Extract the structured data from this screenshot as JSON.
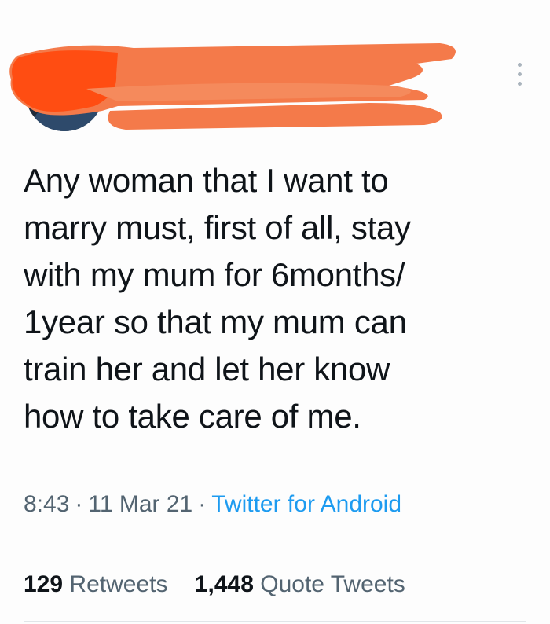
{
  "tweet": {
    "text": "Any woman that I want to\nmarry must, first of all, stay\nwith my mum for 6months/\n1year so that my mum can\ntrain her and let her know\nhow to take care of me.",
    "time": "8:43",
    "date": "11 Mar 21",
    "separator": "·",
    "source": "Twitter for Android"
  },
  "stats": {
    "retweets_count": "129",
    "retweets_label": "Retweets",
    "quotes_count": "1,448",
    "quotes_label": "Quote Tweets"
  },
  "icons": {
    "more": "more-vertical-icon"
  },
  "colors": {
    "text": "#0f1419",
    "secondary": "#536471",
    "link": "#1d9bf0",
    "redaction": "#f47a4a",
    "redaction_dark": "#ff4d12"
  }
}
